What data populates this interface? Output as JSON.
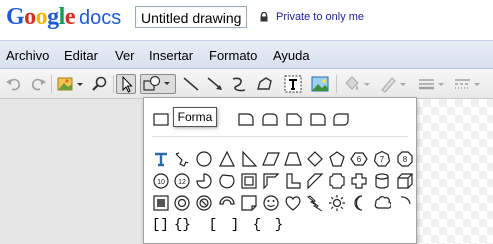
{
  "header": {
    "logo_google": "Google",
    "logo_docs": "docs",
    "document_title": "Untitled drawing",
    "sharing_status": "Private to only me"
  },
  "colors": {
    "google_blue": "#1f5cd1",
    "google_red": "#d62d20",
    "google_yellow": "#f6b400",
    "google_green": "#0f9d58",
    "menubar": "#dce4f0"
  },
  "menu": {
    "items": [
      "Archivo",
      "Editar",
      "Ver",
      "Insertar",
      "Formato",
      "Ayuda"
    ]
  },
  "toolbar": {
    "items": [
      {
        "icon": "undo-icon",
        "enabled": false
      },
      {
        "icon": "redo-icon",
        "enabled": false
      },
      {
        "icon": "image-palette-icon",
        "enabled": true,
        "dropdown": true
      },
      {
        "icon": "zoom-icon",
        "enabled": true
      },
      {
        "icon": "select-arrow-icon",
        "enabled": true,
        "active": true
      },
      {
        "icon": "shape-icon",
        "enabled": true,
        "active": true,
        "dropdown": true
      },
      {
        "icon": "line-icon",
        "enabled": true
      },
      {
        "icon": "arrow-icon",
        "enabled": true
      },
      {
        "icon": "curve-icon",
        "enabled": true
      },
      {
        "icon": "polyline-icon",
        "enabled": true
      },
      {
        "icon": "text-box-icon",
        "enabled": true
      },
      {
        "icon": "image-icon",
        "enabled": true
      },
      {
        "icon": "fill-color-icon",
        "enabled": false
      },
      {
        "icon": "line-color-icon",
        "enabled": false
      },
      {
        "icon": "line-weight-icon",
        "enabled": false
      },
      {
        "icon": "line-dash-icon",
        "enabled": false
      }
    ]
  },
  "shape_menu": {
    "tooltip": "Forma",
    "basic_shapes": [
      "rectangle",
      "rounded-rectangle",
      "snip-rectangle",
      "round-single-corner-rectangle",
      "round-two-corners-rectangle",
      "rounded-top-rectangle",
      "round-diagonal-rectangle",
      "snip-round-rectangle"
    ],
    "more_shapes_row1": [
      "text-t",
      "wrench",
      "oval",
      "triangle",
      "right-triangle",
      "parallelogram",
      "trapezoid",
      "diamond",
      "pentagon",
      "hexagon-6",
      "heptagon-7",
      "octagon-8"
    ],
    "more_shapes_row2": [
      "decagon-10",
      "dodecagon-12",
      "pie",
      "chord",
      "teardrop",
      "frame",
      "half-frame",
      "l-shape",
      "diagonal-stripe",
      "plaque",
      "cross",
      "cylinder",
      "cube"
    ],
    "more_shapes_row3": [
      "bevel",
      "donut",
      "no-symbol",
      "block-arc",
      "folded-corner",
      "smiley",
      "heart",
      "lightning",
      "sun",
      "moon",
      "cloud",
      "arc"
    ],
    "brackets_row": [
      "left-bracket",
      "right-bracket",
      "left-brace",
      "right-brace",
      "bracket-pair",
      "brace-pair"
    ],
    "bracket_glyphs": [
      "[",
      "]",
      "{",
      "}",
      "[",
      "]",
      "{",
      "}"
    ]
  }
}
